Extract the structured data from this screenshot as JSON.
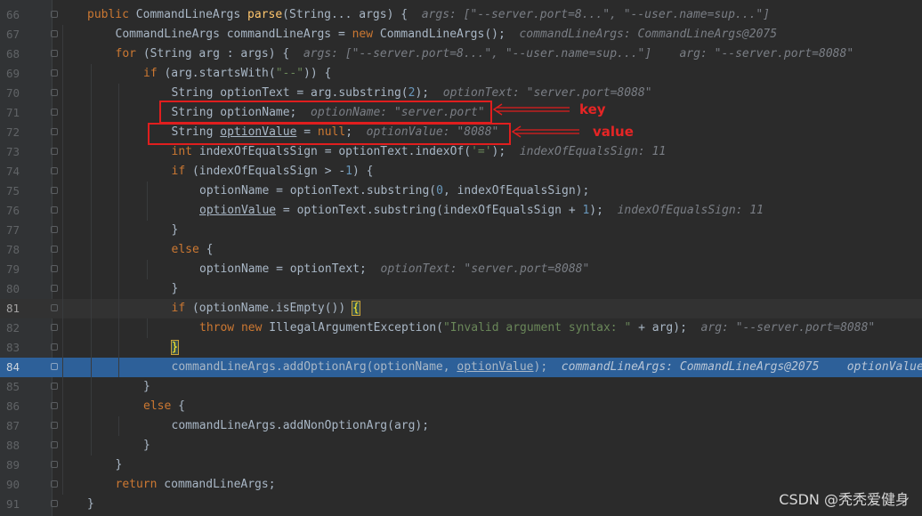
{
  "lines": [
    {
      "n": "66",
      "indent": 1,
      "tokens": [
        {
          "t": "public ",
          "c": "kw"
        },
        {
          "t": "CommandLineArgs ",
          "c": "ty"
        },
        {
          "t": "parse",
          "c": "fn"
        },
        {
          "t": "(String... args) {",
          "c": "plain"
        },
        {
          "t": "  args: [\"--server.port=8...\", \"--user.name=sup...\"]",
          "c": "hint"
        }
      ]
    },
    {
      "n": "67",
      "indent": 2,
      "tokens": [
        {
          "t": "CommandLineArgs commandLineArgs = ",
          "c": "plain"
        },
        {
          "t": "new ",
          "c": "kw"
        },
        {
          "t": "CommandLineArgs();",
          "c": "plain"
        },
        {
          "t": "  commandLineArgs: CommandLineArgs@2075",
          "c": "hint"
        }
      ]
    },
    {
      "n": "68",
      "indent": 2,
      "tokens": [
        {
          "t": "for ",
          "c": "kw"
        },
        {
          "t": "(String arg : args) {",
          "c": "plain"
        },
        {
          "t": "  args: [\"--server.port=8...\", \"--user.name=sup...\"]    arg: \"--server.port=8088\"",
          "c": "hint"
        }
      ]
    },
    {
      "n": "69",
      "indent": 3,
      "tokens": [
        {
          "t": "if ",
          "c": "kw"
        },
        {
          "t": "(arg.startsWith(",
          "c": "plain"
        },
        {
          "t": "\"--\"",
          "c": "str"
        },
        {
          "t": ")) {",
          "c": "plain"
        }
      ]
    },
    {
      "n": "70",
      "indent": 4,
      "tokens": [
        {
          "t": "String optionText = arg.substring(",
          "c": "plain"
        },
        {
          "t": "2",
          "c": "num"
        },
        {
          "t": ");",
          "c": "plain"
        },
        {
          "t": "  optionText: \"server.port=8088\"",
          "c": "hint"
        }
      ]
    },
    {
      "n": "71",
      "indent": 4,
      "tokens": [
        {
          "t": "String optionName;",
          "c": "plain"
        },
        {
          "t": "  optionName: \"server.port\"",
          "c": "hint"
        }
      ]
    },
    {
      "n": "72",
      "indent": 4,
      "tokens": [
        {
          "t": "String ",
          "c": "plain"
        },
        {
          "t": "optionValue",
          "c": "plain ul"
        },
        {
          "t": " = ",
          "c": "plain"
        },
        {
          "t": "null",
          "c": "kw"
        },
        {
          "t": ";",
          "c": "plain"
        },
        {
          "t": "  optionValue: \"8088\"",
          "c": "hint"
        }
      ]
    },
    {
      "n": "73",
      "indent": 4,
      "tokens": [
        {
          "t": "int ",
          "c": "kw"
        },
        {
          "t": "indexOfEqualsSign = optionText.indexOf(",
          "c": "plain"
        },
        {
          "t": "'='",
          "c": "str"
        },
        {
          "t": ");",
          "c": "plain"
        },
        {
          "t": "  indexOfEqualsSign: 11",
          "c": "hint"
        }
      ]
    },
    {
      "n": "74",
      "indent": 4,
      "tokens": [
        {
          "t": "if ",
          "c": "kw"
        },
        {
          "t": "(indexOfEqualsSign > -",
          "c": "plain"
        },
        {
          "t": "1",
          "c": "num"
        },
        {
          "t": ") {",
          "c": "plain"
        }
      ]
    },
    {
      "n": "75",
      "indent": 5,
      "tokens": [
        {
          "t": "optionName = optionText.substring(",
          "c": "plain"
        },
        {
          "t": "0",
          "c": "num"
        },
        {
          "t": ", indexOfEqualsSign);",
          "c": "plain"
        }
      ]
    },
    {
      "n": "76",
      "indent": 5,
      "tokens": [
        {
          "t": "optionValue",
          "c": "plain ul"
        },
        {
          "t": " = optionText.substring(indexOfEqualsSign + ",
          "c": "plain"
        },
        {
          "t": "1",
          "c": "num"
        },
        {
          "t": ");",
          "c": "plain"
        },
        {
          "t": "  indexOfEqualsSign: 11",
          "c": "hint"
        }
      ]
    },
    {
      "n": "77",
      "indent": 4,
      "tokens": [
        {
          "t": "}",
          "c": "plain"
        }
      ]
    },
    {
      "n": "78",
      "indent": 4,
      "tokens": [
        {
          "t": "else ",
          "c": "kw"
        },
        {
          "t": "{",
          "c": "plain"
        }
      ]
    },
    {
      "n": "79",
      "indent": 5,
      "tokens": [
        {
          "t": "optionName = optionText;",
          "c": "plain"
        },
        {
          "t": "  optionText: \"server.port=8088\"",
          "c": "hint"
        }
      ]
    },
    {
      "n": "80",
      "indent": 4,
      "tokens": [
        {
          "t": "}",
          "c": "plain"
        }
      ]
    },
    {
      "n": "81",
      "indent": 4,
      "style": "caret",
      "tokens": [
        {
          "t": "if ",
          "c": "kw"
        },
        {
          "t": "(optionName.isEmpty()) ",
          "c": "plain"
        },
        {
          "t": "{",
          "c": "plain brace-match"
        }
      ]
    },
    {
      "n": "82",
      "indent": 5,
      "tokens": [
        {
          "t": "throw new ",
          "c": "kw"
        },
        {
          "t": "IllegalArgumentException(",
          "c": "plain"
        },
        {
          "t": "\"Invalid argument syntax: \"",
          "c": "str"
        },
        {
          "t": " + arg);",
          "c": "plain"
        },
        {
          "t": "  arg: \"--server.port=8088\"",
          "c": "hint"
        }
      ]
    },
    {
      "n": "83",
      "indent": 4,
      "tokens": [
        {
          "t": "}",
          "c": "plain brace-match"
        }
      ]
    },
    {
      "n": "84",
      "indent": 4,
      "style": "exec",
      "tokens": [
        {
          "t": "commandLineArgs.addOptionArg(optionName, ",
          "c": "plain"
        },
        {
          "t": "optionValue",
          "c": "plain ul"
        },
        {
          "t": ");",
          "c": "plain"
        },
        {
          "t": "  commandLineArgs: CommandLineArgs@2075    optionValue",
          "c": "hint"
        }
      ]
    },
    {
      "n": "85",
      "indent": 3,
      "tokens": [
        {
          "t": "}",
          "c": "plain"
        }
      ]
    },
    {
      "n": "86",
      "indent": 3,
      "tokens": [
        {
          "t": "else ",
          "c": "kw"
        },
        {
          "t": "{",
          "c": "plain"
        }
      ]
    },
    {
      "n": "87",
      "indent": 4,
      "tokens": [
        {
          "t": "commandLineArgs.addNonOptionArg(arg);",
          "c": "plain"
        }
      ]
    },
    {
      "n": "88",
      "indent": 3,
      "tokens": [
        {
          "t": "}",
          "c": "plain"
        }
      ]
    },
    {
      "n": "89",
      "indent": 2,
      "tokens": [
        {
          "t": "}",
          "c": "plain"
        }
      ]
    },
    {
      "n": "90",
      "indent": 2,
      "tokens": [
        {
          "t": "return ",
          "c": "kw"
        },
        {
          "t": "commandLineArgs;",
          "c": "plain"
        }
      ]
    },
    {
      "n": "91",
      "indent": 1,
      "tokens": [
        {
          "t": "}",
          "c": "plain"
        }
      ]
    }
  ],
  "annotations": {
    "key_label": "key",
    "value_label": "value"
  },
  "watermark": "CSDN @秃秃爱健身",
  "colors": {
    "background": "#2b2b2b",
    "exec_line": "#2d6099",
    "annotation_red": "#e01e1e"
  }
}
